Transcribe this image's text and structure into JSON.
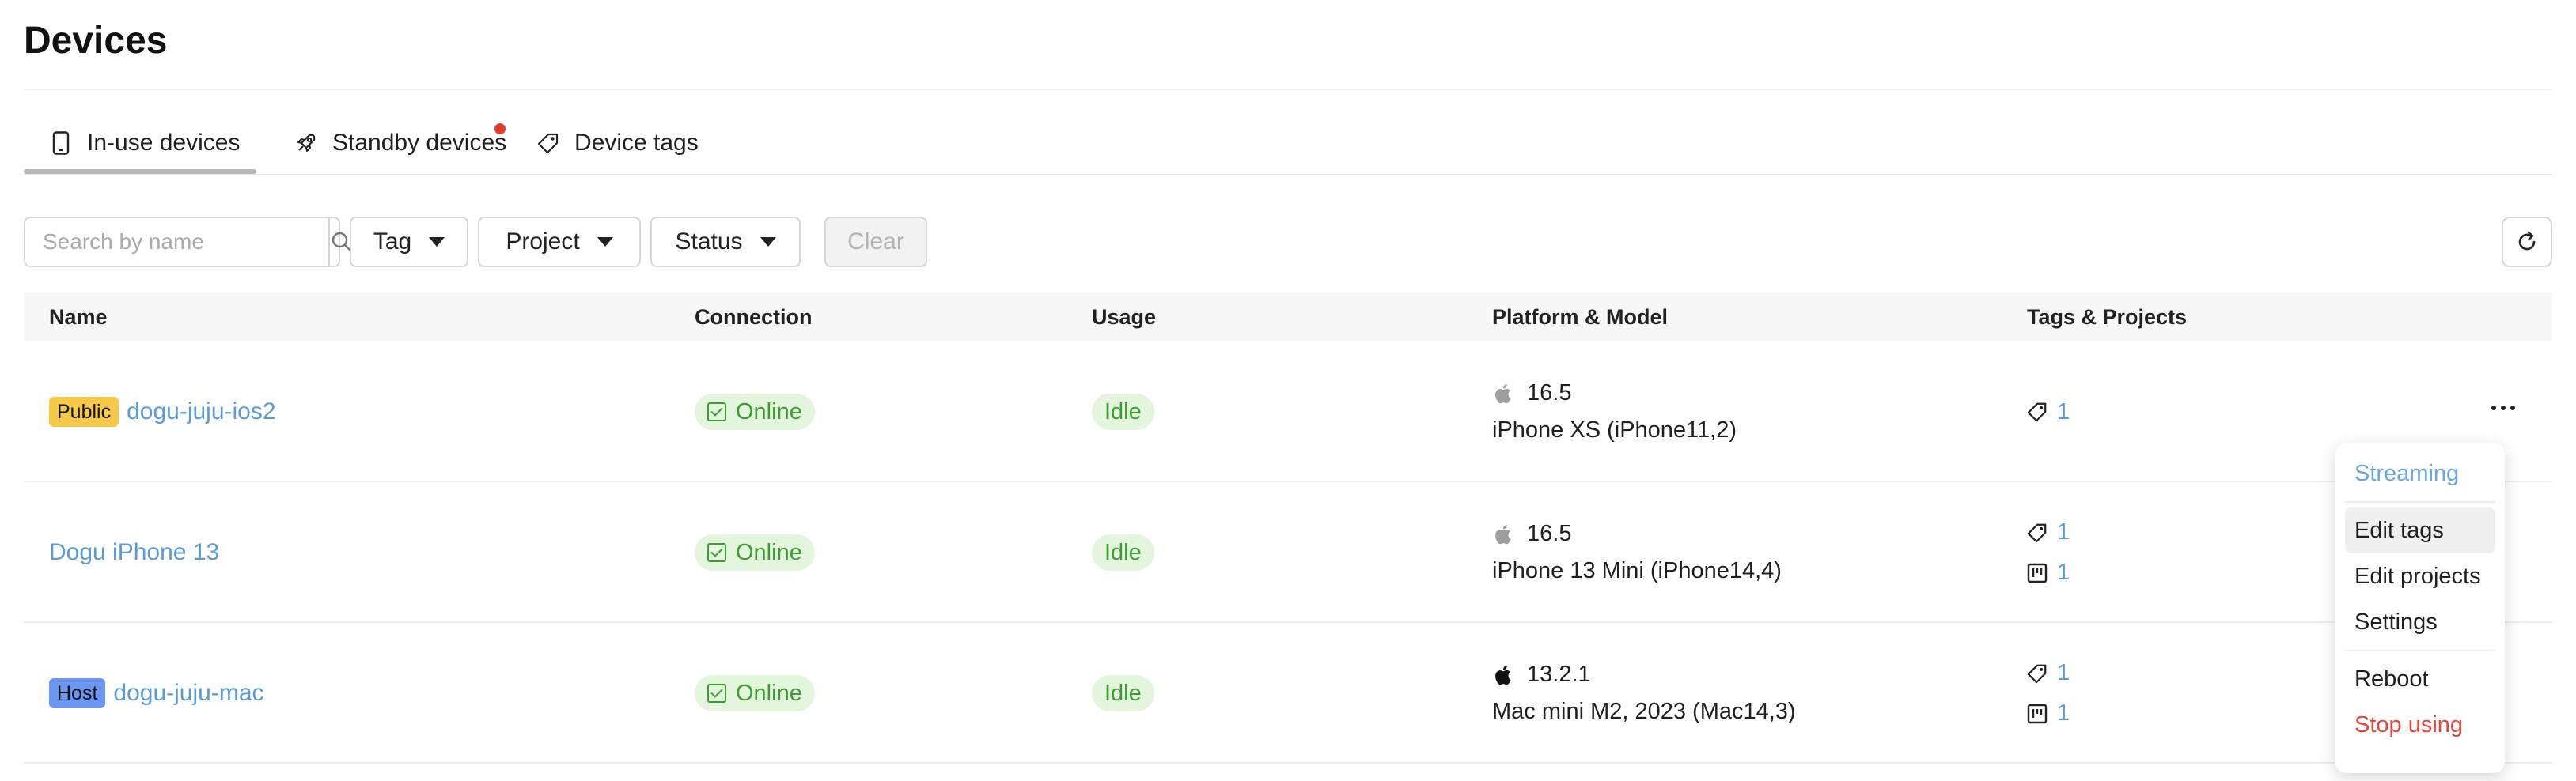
{
  "page": {
    "title": "Devices"
  },
  "tabs": [
    {
      "label": "In-use devices",
      "icon": "phone-icon",
      "active": true
    },
    {
      "label": "Standby devices",
      "icon": "rocket-icon",
      "has_notification": true
    },
    {
      "label": "Device tags",
      "icon": "tag-icon"
    }
  ],
  "filters": {
    "search_placeholder": "Search by name",
    "tag_label": "Tag",
    "project_label": "Project",
    "status_label": "Status",
    "clear_label": "Clear"
  },
  "table": {
    "headers": [
      "Name",
      "Connection",
      "Usage",
      "Platform & Model",
      "Tags & Projects"
    ],
    "rows": [
      {
        "badge": "Public",
        "badge_color": "#f7c948",
        "name": "dogu-juju-ios2",
        "connection": "Online",
        "usage": "Idle",
        "platform_icon": "apple-icon",
        "platform_icon_color": "#9e9e9e",
        "os_version": "16.5",
        "model": "iPhone XS (iPhone11,2)",
        "tags_count": "1",
        "projects_count": ""
      },
      {
        "badge": "",
        "badge_color": "",
        "name": "Dogu iPhone 13",
        "connection": "Online",
        "usage": "Idle",
        "platform_icon": "apple-icon",
        "platform_icon_color": "#9e9e9e",
        "os_version": "16.5",
        "model": "iPhone 13 Mini (iPhone14,4)",
        "tags_count": "1",
        "projects_count": "1"
      },
      {
        "badge": "Host",
        "badge_color": "#6b96f2",
        "name": "dogu-juju-mac",
        "connection": "Online",
        "usage": "Idle",
        "platform_icon": "apple-icon",
        "platform_icon_color": "#111111",
        "os_version": "13.2.1",
        "model": "Mac mini M2, 2023 (Mac14,3)",
        "tags_count": "1",
        "projects_count": "1"
      }
    ]
  },
  "context_menu": {
    "items": [
      "Streaming",
      "Edit tags",
      "Edit projects",
      "Settings",
      "Reboot",
      "Stop using"
    ]
  },
  "colors": {
    "link": "#5b9bd5",
    "online_bg": "#e4f5de",
    "online_text": "#3f9c35",
    "danger": "#e3473b",
    "notification": "#e23b2e"
  }
}
